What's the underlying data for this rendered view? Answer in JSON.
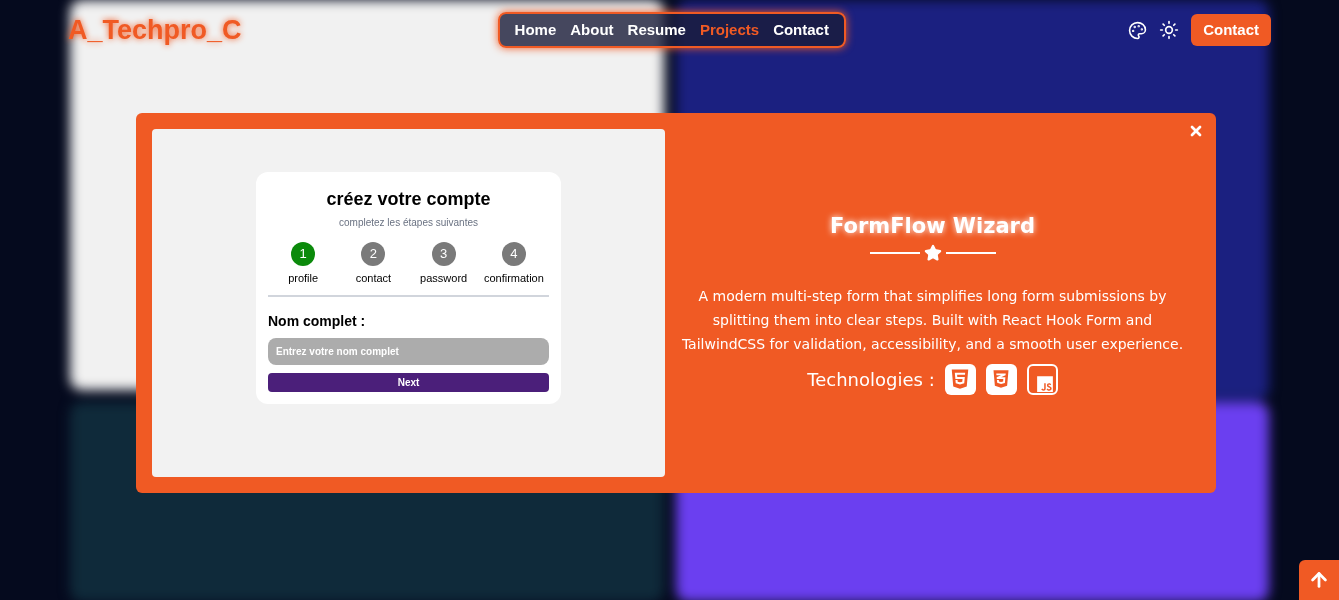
{
  "header": {
    "logo": "A_Techpro_C",
    "nav": [
      {
        "label": "Home",
        "selected": false
      },
      {
        "label": "About",
        "selected": false
      },
      {
        "label": "Resume",
        "selected": false
      },
      {
        "label": "Projects",
        "selected": true
      },
      {
        "label": "Contact",
        "selected": false
      }
    ],
    "contact_button": "Contact"
  },
  "modal": {
    "preview": {
      "title": "créez votre compte",
      "subtitle": "completez les étapes suivantes",
      "steps": [
        {
          "number": "1",
          "label": "profile",
          "selected": true
        },
        {
          "number": "2",
          "label": "contact",
          "selected": false
        },
        {
          "number": "3",
          "label": "password",
          "selected": false
        },
        {
          "number": "4",
          "label": "confirmation",
          "selected": false
        }
      ],
      "field_label": "Nom complet :",
      "field_placeholder": "Entrez votre nom complet",
      "next_button": "Next"
    },
    "title": "FormFlow Wizard",
    "description": "A modern multi-step form that simplifies long form submissions by splitting them into clear steps. Built with React Hook Form and TailwindCSS for validation, accessibility, and a smooth user experience.",
    "technologies_label": "Technologies :",
    "technologies": [
      {
        "kind": "html"
      },
      {
        "kind": "css"
      },
      {
        "kind": "js"
      }
    ]
  }
}
